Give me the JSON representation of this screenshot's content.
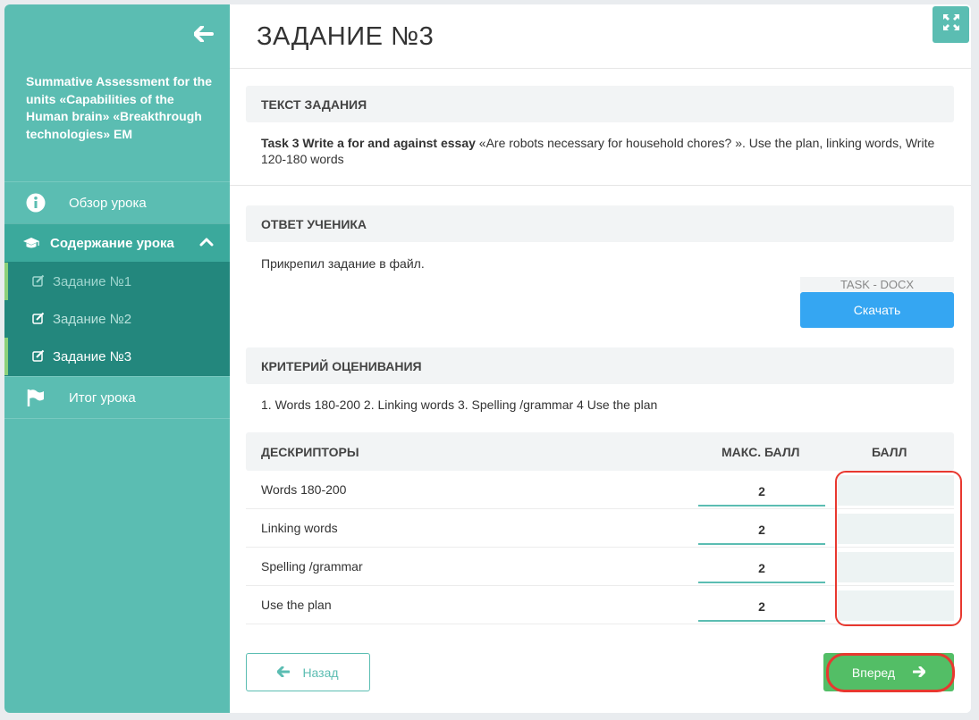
{
  "sidebar": {
    "course_title": "Summative Assessment for the units «Capabilities of the Human brain» «Breakthrough technologies» EM",
    "overview_label": "Обзор урока",
    "content_label": "Содержание урока",
    "tasks": [
      {
        "label": "Задание №1",
        "state": "visited"
      },
      {
        "label": "Задание №2",
        "state": "default"
      },
      {
        "label": "Задание №3",
        "state": "active"
      }
    ],
    "summary_label": "Итог урока"
  },
  "header": {
    "title": "ЗАДАНИЕ №3"
  },
  "task_text": {
    "heading": "ТЕКСТ ЗАДАНИЯ",
    "bold_part": "Task 3 Write a for and against essay",
    "rest_part": " «Are robots necessary for household chores? ». Use the plan, linking words, Write 120-180 words"
  },
  "student_answer": {
    "heading": "ОТВЕТ УЧЕНИКА",
    "text": "Прикрепил задание в файл.",
    "file_label": "TASK - DOCX",
    "download_label": "Скачать"
  },
  "criteria": {
    "heading": "КРИТЕРИЙ ОЦЕНИВАНИЯ",
    "text": "1. Words 180-200 2. Linking words 3. Spelling /grammar 4 Use the plan"
  },
  "descriptors_table": {
    "headers": {
      "descriptors": "ДЕСКРИПТОРЫ",
      "max_score": "МАКС. БАЛЛ",
      "score": "БАЛЛ"
    },
    "rows": [
      {
        "descriptor": "Words 180-200",
        "max": "2",
        "score": ""
      },
      {
        "descriptor": "Linking words",
        "max": "2",
        "score": ""
      },
      {
        "descriptor": "Spelling /grammar",
        "max": "2",
        "score": ""
      },
      {
        "descriptor": "Use the plan",
        "max": "2",
        "score": ""
      }
    ]
  },
  "footer": {
    "back_label": "Назад",
    "next_label": "Вперед"
  },
  "colors": {
    "teal": "#5bbdb2",
    "teal_dark": "#23877d",
    "blue_button": "#35a6f2",
    "green_button": "#53be66",
    "annotation_red": "#e8382f"
  }
}
